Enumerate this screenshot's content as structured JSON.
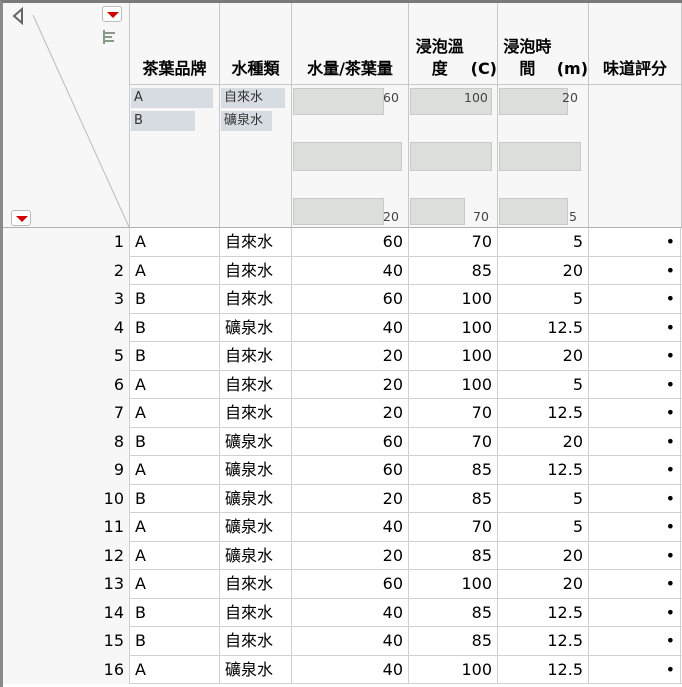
{
  "columns": [
    "茶葉品牌",
    "水種類",
    "水量/茶葉量",
    "浸泡溫度\n(C)",
    "浸泡時間\n(m)",
    "味道評分"
  ],
  "col_names": {
    "brand": "茶葉品牌",
    "water": "水種類",
    "amount": "水量/茶葉量",
    "temp1": "浸泡溫度",
    "temp2": "(C)",
    "time1": "浸泡時間",
    "time2": "(m)",
    "taste": "味道評分"
  },
  "summary": {
    "brand": [
      "A",
      "B"
    ],
    "water": [
      "自來水",
      "礦泉水"
    ],
    "amount": {
      "max": "60",
      "min": "20"
    },
    "temp": {
      "max": "100",
      "min": "70"
    },
    "time": {
      "max": "20",
      "min": "5"
    }
  },
  "rows": [
    [
      "1",
      "A",
      "自來水",
      "60",
      "70",
      "5",
      "•"
    ],
    [
      "2",
      "A",
      "自來水",
      "40",
      "85",
      "20",
      "•"
    ],
    [
      "3",
      "B",
      "自來水",
      "60",
      "100",
      "5",
      "•"
    ],
    [
      "4",
      "B",
      "礦泉水",
      "40",
      "100",
      "12.5",
      "•"
    ],
    [
      "5",
      "B",
      "自來水",
      "20",
      "100",
      "20",
      "•"
    ],
    [
      "6",
      "A",
      "自來水",
      "20",
      "100",
      "5",
      "•"
    ],
    [
      "7",
      "A",
      "自來水",
      "20",
      "70",
      "12.5",
      "•"
    ],
    [
      "8",
      "B",
      "礦泉水",
      "60",
      "70",
      "20",
      "•"
    ],
    [
      "9",
      "A",
      "礦泉水",
      "60",
      "85",
      "12.5",
      "•"
    ],
    [
      "10",
      "B",
      "礦泉水",
      "20",
      "85",
      "5",
      "•"
    ],
    [
      "11",
      "A",
      "礦泉水",
      "40",
      "70",
      "5",
      "•"
    ],
    [
      "12",
      "A",
      "礦泉水",
      "20",
      "85",
      "20",
      "•"
    ],
    [
      "13",
      "A",
      "自來水",
      "60",
      "100",
      "20",
      "•"
    ],
    [
      "14",
      "B",
      "自來水",
      "40",
      "85",
      "12.5",
      "•"
    ],
    [
      "15",
      "B",
      "自來水",
      "40",
      "85",
      "12.5",
      "•"
    ],
    [
      "16",
      "A",
      "礦泉水",
      "40",
      "100",
      "12.5",
      "•"
    ]
  ]
}
